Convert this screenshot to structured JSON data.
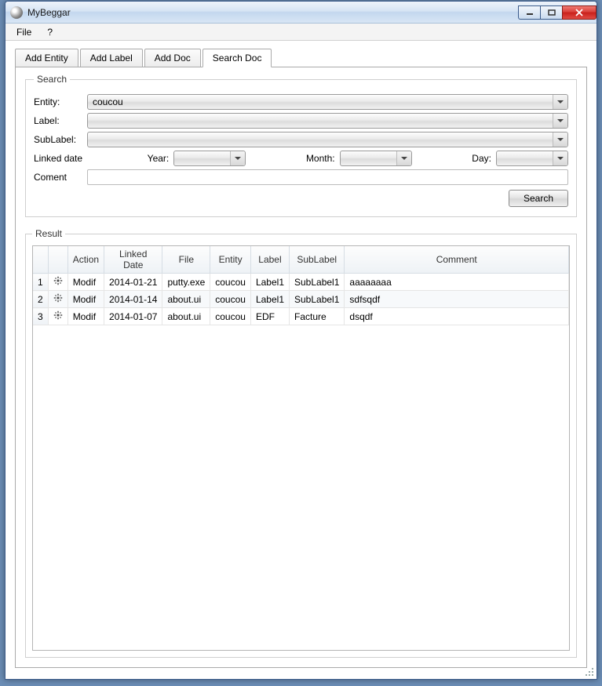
{
  "window": {
    "title": "MyBeggar"
  },
  "menu": {
    "file": "File",
    "help": "?"
  },
  "tabs": [
    {
      "label": "Add Entity"
    },
    {
      "label": "Add Label"
    },
    {
      "label": "Add Doc"
    },
    {
      "label": "Search Doc"
    }
  ],
  "search": {
    "legend": "Search",
    "entity_label": "Entity:",
    "entity_value": "coucou",
    "label_label": "Label:",
    "label_value": "",
    "sublabel_label": "SubLabel:",
    "sublabel_value": "",
    "linkeddate_label": "Linked date",
    "year_label": "Year:",
    "year_value": "",
    "month_label": "Month:",
    "month_value": "",
    "day_label": "Day:",
    "day_value": "",
    "comment_label": "Coment",
    "comment_value": "",
    "button": "Search"
  },
  "result": {
    "legend": "Result",
    "headers": {
      "num": "",
      "gear": "",
      "action": "Action",
      "linked_date": "Linked Date",
      "file": "File",
      "entity": "Entity",
      "label": "Label",
      "sublabel": "SubLabel",
      "comment": "Comment"
    },
    "rows": [
      {
        "num": "1",
        "action": "Modif",
        "linked_date": "2014-01-21",
        "file": "putty.exe",
        "entity": "coucou",
        "label": "Label1",
        "sublabel": "SubLabel1",
        "comment": "aaaaaaaa"
      },
      {
        "num": "2",
        "action": "Modif",
        "linked_date": "2014-01-14",
        "file": "about.ui",
        "entity": "coucou",
        "label": "Label1",
        "sublabel": "SubLabel1",
        "comment": "sdfsqdf"
      },
      {
        "num": "3",
        "action": "Modif",
        "linked_date": "2014-01-07",
        "file": "about.ui",
        "entity": "coucou",
        "label": "EDF",
        "sublabel": "Facture",
        "comment": "dsqdf"
      }
    ]
  }
}
